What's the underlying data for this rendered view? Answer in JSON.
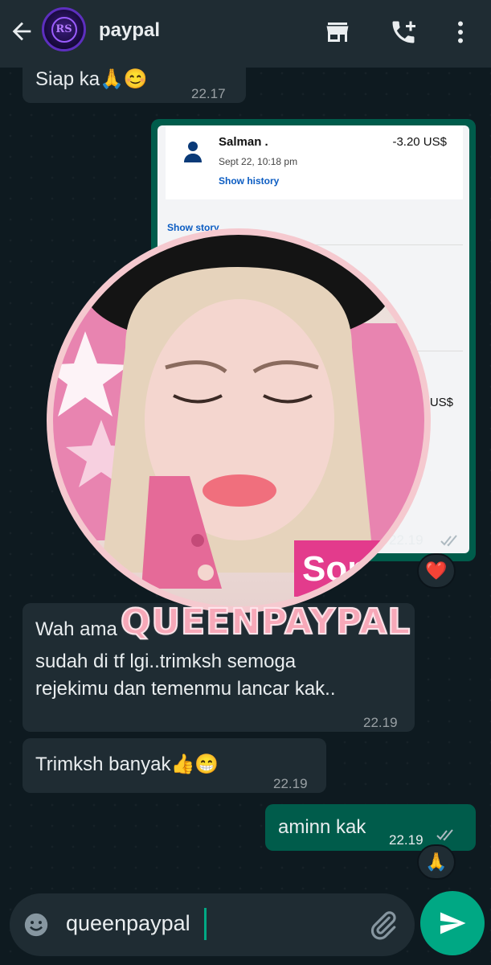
{
  "header": {
    "title": "paypal",
    "avatar_text": "RS"
  },
  "messages": {
    "m1": {
      "text": "Siap ka🙏😊",
      "time": "22.17"
    },
    "m2": {
      "time": "22.19"
    },
    "m3": {
      "text": "Wah ama",
      "text2": "sudah di tf lgi..trimksh semoga",
      "text3": "rejekimu dan temenmu lancar kak..",
      "time": "22.19"
    },
    "m4": {
      "text": "Trimksh banyak👍😁",
      "time": "22.19"
    },
    "m5": {
      "text": "aminn kak",
      "time": "22.19"
    }
  },
  "reactions": {
    "r1": "❤️",
    "r2": "🙏"
  },
  "paypal_shot": {
    "name": "Salman .",
    "date": "Sept 22, 10:18 pm",
    "history": "Show history",
    "amount": "-3.20 US$",
    "story": "Show story",
    "amount2": "US$"
  },
  "watermark": {
    "text": "QUEENPAYPAL",
    "badge": "Son"
  },
  "composer": {
    "value": "queenpaypal"
  },
  "colors": {
    "header": "#1f2c33",
    "outgoing": "#005c4b",
    "incoming": "#1f2c33",
    "accent": "#00a884",
    "watermark": "#f7a8b8"
  }
}
